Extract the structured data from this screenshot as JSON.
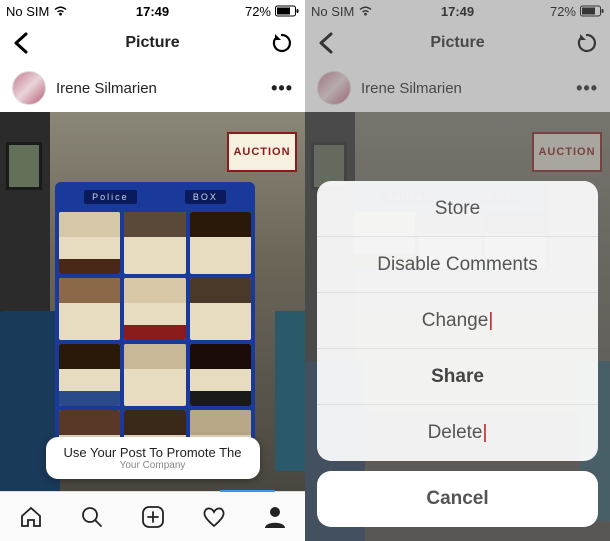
{
  "status": {
    "carrier": "No SIM",
    "time": "17:49",
    "battery_pct": "72%"
  },
  "nav": {
    "title": "Picture"
  },
  "user": {
    "name": "Irene Silmarien"
  },
  "photo": {
    "sign_text": "AUCTION",
    "tardis_left": "Police",
    "tardis_right": "BOX"
  },
  "promo": {
    "main": "Use Your Post To Promote The",
    "sub": "Your Company"
  },
  "sheet": {
    "store": "Store",
    "disable_comments": "Disable Comments",
    "change": "Change",
    "share": "Share",
    "delete": "Delete",
    "cancel": "Cancel"
  }
}
